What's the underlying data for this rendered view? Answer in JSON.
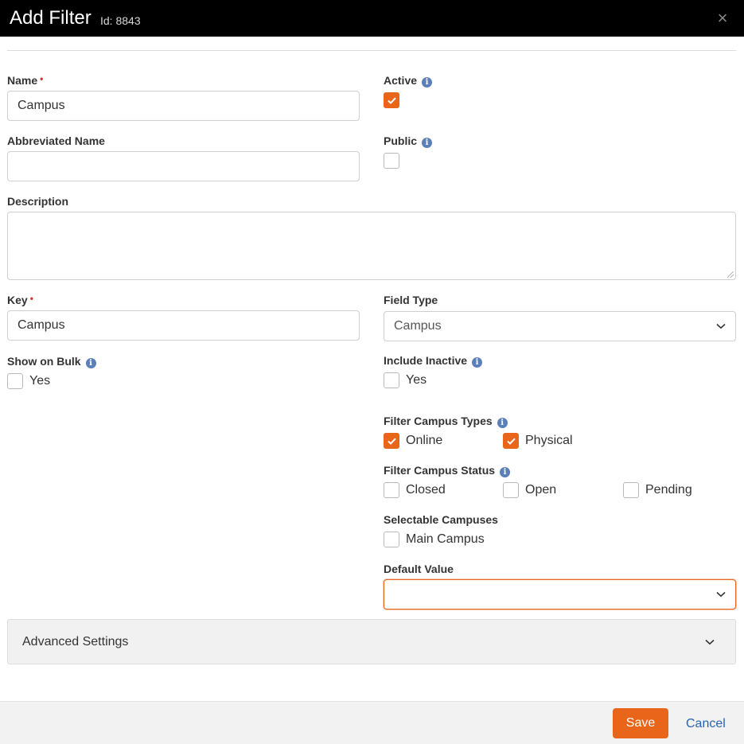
{
  "header": {
    "title": "Add Filter",
    "id_label": "Id: 8843",
    "close_glyph": "×"
  },
  "form": {
    "name": {
      "label": "Name",
      "required_mark": "•",
      "value": "Campus"
    },
    "abbreviated_name": {
      "label": "Abbreviated Name",
      "value": ""
    },
    "active": {
      "label": "Active",
      "checked": true
    },
    "public": {
      "label": "Public",
      "checked": false
    },
    "description": {
      "label": "Description",
      "value": ""
    },
    "key": {
      "label": "Key",
      "required_mark": "•",
      "value": "Campus"
    },
    "field_type": {
      "label": "Field Type",
      "value": "Campus"
    },
    "show_on_bulk": {
      "label": "Show on Bulk",
      "option_label": "Yes",
      "checked": false
    },
    "include_inactive": {
      "label": "Include Inactive",
      "option_label": "Yes",
      "checked": false
    },
    "filter_campus_types": {
      "label": "Filter Campus Types",
      "options": [
        {
          "label": "Online",
          "checked": true
        },
        {
          "label": "Physical",
          "checked": true
        }
      ]
    },
    "filter_campus_status": {
      "label": "Filter Campus Status",
      "options": [
        {
          "label": "Closed",
          "checked": false
        },
        {
          "label": "Open",
          "checked": false
        },
        {
          "label": "Pending",
          "checked": false
        }
      ]
    },
    "selectable_campuses": {
      "label": "Selectable Campuses",
      "options": [
        {
          "label": "Main Campus",
          "checked": false
        }
      ]
    },
    "default_value": {
      "label": "Default Value",
      "value": ""
    },
    "info_glyph": "i"
  },
  "advanced_settings": {
    "title": "Advanced Settings"
  },
  "footer": {
    "save_label": "Save",
    "cancel_label": "Cancel"
  },
  "colors": {
    "accent": "#e8651a",
    "header_bg": "#000000",
    "link": "#2a63b0",
    "info": "#5b7fb8",
    "required": "#d0342c"
  },
  "icons": {
    "close": "close-icon",
    "info": "info-icon",
    "chevron": "chevron-down-icon",
    "check": "check-icon"
  }
}
